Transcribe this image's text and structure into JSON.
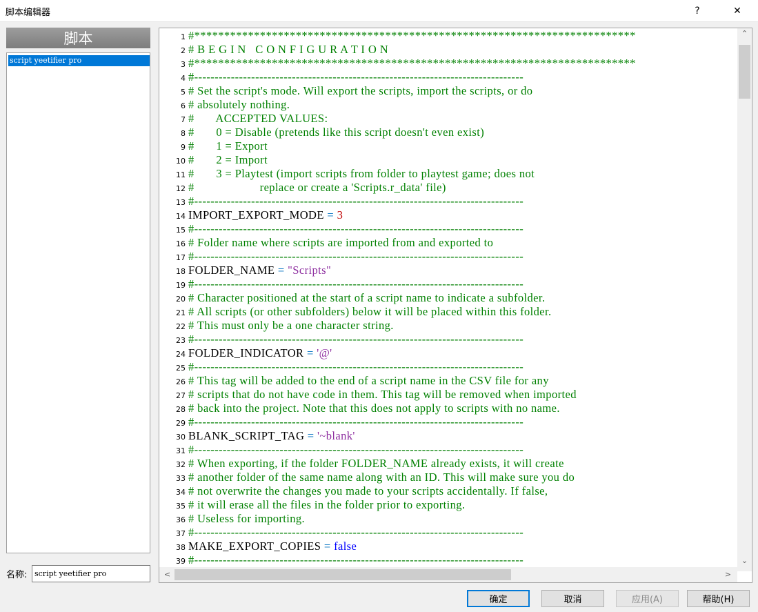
{
  "window": {
    "title": "脚本编辑器",
    "help_glyph": "?",
    "close_glyph": "✕"
  },
  "left_panel": {
    "header": "脚本",
    "scripts": [
      "script yeetifier pro"
    ],
    "name_label": "名称:",
    "name_value": "script yeetifier pro"
  },
  "editor": {
    "lines": [
      {
        "n": "1",
        "segs": [
          {
            "t": "#**************************************************************************",
            "c": "c-comment"
          }
        ]
      },
      {
        "n": "2",
        "segs": [
          {
            "t": "# B E G I N   C O N F I G U R A T I O N",
            "c": "c-comment"
          }
        ]
      },
      {
        "n": "3",
        "segs": [
          {
            "t": "#**************************************************************************",
            "c": "c-comment"
          }
        ]
      },
      {
        "n": "4",
        "segs": [
          {
            "t": "#---------------------------------------------------------------------------------",
            "c": "c-comment"
          }
        ]
      },
      {
        "n": "5",
        "segs": [
          {
            "t": "# Set the script's mode. Will export the scripts, import the scripts, or do",
            "c": "c-comment"
          }
        ]
      },
      {
        "n": "6",
        "segs": [
          {
            "t": "# absolutely nothing.",
            "c": "c-comment"
          }
        ]
      },
      {
        "n": "7",
        "segs": [
          {
            "t": "#       ACCEPTED VALUES:",
            "c": "c-comment"
          }
        ]
      },
      {
        "n": "8",
        "segs": [
          {
            "t": "#       0 = Disable (pretends like this script doesn't even exist)",
            "c": "c-comment"
          }
        ]
      },
      {
        "n": "9",
        "segs": [
          {
            "t": "#       1 = Export",
            "c": "c-comment"
          }
        ]
      },
      {
        "n": "10",
        "segs": [
          {
            "t": "#       2 = Import",
            "c": "c-comment"
          }
        ]
      },
      {
        "n": "11",
        "segs": [
          {
            "t": "#       3 = Playtest (import scripts from folder to playtest game; does not",
            "c": "c-comment"
          }
        ]
      },
      {
        "n": "12",
        "segs": [
          {
            "t": "#                     replace or create a 'Scripts.r_data' file)",
            "c": "c-comment"
          }
        ]
      },
      {
        "n": "13",
        "segs": [
          {
            "t": "#---------------------------------------------------------------------------------",
            "c": "c-comment"
          }
        ]
      },
      {
        "n": "14",
        "segs": [
          {
            "t": "IMPORT_EXPORT_MODE",
            "c": "c-plain"
          },
          {
            "t": " = ",
            "c": "c-op"
          },
          {
            "t": "3",
            "c": "c-num"
          }
        ]
      },
      {
        "n": "15",
        "segs": [
          {
            "t": "#---------------------------------------------------------------------------------",
            "c": "c-comment"
          }
        ]
      },
      {
        "n": "16",
        "segs": [
          {
            "t": "# Folder name where scripts are imported from and exported to",
            "c": "c-comment"
          }
        ]
      },
      {
        "n": "17",
        "segs": [
          {
            "t": "#---------------------------------------------------------------------------------",
            "c": "c-comment"
          }
        ]
      },
      {
        "n": "18",
        "segs": [
          {
            "t": "FOLDER_NAME",
            "c": "c-plain"
          },
          {
            "t": " = ",
            "c": "c-op"
          },
          {
            "t": "\"Scripts\"",
            "c": "c-str"
          }
        ]
      },
      {
        "n": "19",
        "segs": [
          {
            "t": "#---------------------------------------------------------------------------------",
            "c": "c-comment"
          }
        ]
      },
      {
        "n": "20",
        "segs": [
          {
            "t": "# Character positioned at the start of a script name to indicate a subfolder.",
            "c": "c-comment"
          }
        ]
      },
      {
        "n": "21",
        "segs": [
          {
            "t": "# All scripts (or other subfolders) below it will be placed within this folder.",
            "c": "c-comment"
          }
        ]
      },
      {
        "n": "22",
        "segs": [
          {
            "t": "# This must only be a one character string.",
            "c": "c-comment"
          }
        ]
      },
      {
        "n": "23",
        "segs": [
          {
            "t": "#---------------------------------------------------------------------------------",
            "c": "c-comment"
          }
        ]
      },
      {
        "n": "24",
        "segs": [
          {
            "t": "FOLDER_INDICATOR",
            "c": "c-plain"
          },
          {
            "t": " = ",
            "c": "c-op"
          },
          {
            "t": "'@'",
            "c": "c-str"
          }
        ]
      },
      {
        "n": "25",
        "segs": [
          {
            "t": "#---------------------------------------------------------------------------------",
            "c": "c-comment"
          }
        ]
      },
      {
        "n": "26",
        "segs": [
          {
            "t": "# This tag will be added to the end of a script name in the CSV file for any",
            "c": "c-comment"
          }
        ]
      },
      {
        "n": "27",
        "segs": [
          {
            "t": "# scripts that do not have code in them. This tag will be removed when imported",
            "c": "c-comment"
          }
        ]
      },
      {
        "n": "28",
        "segs": [
          {
            "t": "# back into the project. Note that this does not apply to scripts with no name.",
            "c": "c-comment"
          }
        ]
      },
      {
        "n": "29",
        "segs": [
          {
            "t": "#---------------------------------------------------------------------------------",
            "c": "c-comment"
          }
        ]
      },
      {
        "n": "30",
        "segs": [
          {
            "t": "BLANK_SCRIPT_TAG",
            "c": "c-plain"
          },
          {
            "t": " = ",
            "c": "c-op"
          },
          {
            "t": "'~blank'",
            "c": "c-str"
          }
        ]
      },
      {
        "n": "31",
        "segs": [
          {
            "t": "#---------------------------------------------------------------------------------",
            "c": "c-comment"
          }
        ]
      },
      {
        "n": "32",
        "segs": [
          {
            "t": "# When exporting, if the folder FOLDER_NAME already exists, it will create",
            "c": "c-comment"
          }
        ]
      },
      {
        "n": "33",
        "segs": [
          {
            "t": "# another folder of the same name along with an ID. This will make sure you do",
            "c": "c-comment"
          }
        ]
      },
      {
        "n": "34",
        "segs": [
          {
            "t": "# not overwrite the changes you made to your scripts accidentally. If false,",
            "c": "c-comment"
          }
        ]
      },
      {
        "n": "35",
        "segs": [
          {
            "t": "# it will erase all the files in the folder prior to exporting.",
            "c": "c-comment"
          }
        ]
      },
      {
        "n": "36",
        "segs": [
          {
            "t": "# Useless for importing.",
            "c": "c-comment"
          }
        ]
      },
      {
        "n": "37",
        "segs": [
          {
            "t": "#---------------------------------------------------------------------------------",
            "c": "c-comment"
          }
        ]
      },
      {
        "n": "38",
        "segs": [
          {
            "t": "MAKE_EXPORT_COPIES",
            "c": "c-plain"
          },
          {
            "t": " = ",
            "c": "c-op"
          },
          {
            "t": "false",
            "c": "c-kw"
          }
        ]
      },
      {
        "n": "39",
        "segs": [
          {
            "t": "#---------------------------------------------------------------------------------",
            "c": "c-comment"
          }
        ]
      }
    ]
  },
  "buttons": {
    "ok": "确定",
    "cancel": "取消",
    "apply": "应用(A)",
    "help": "帮助(H)"
  },
  "scroll_glyphs": {
    "up": "⌃",
    "down": "⌄",
    "left": "<",
    "right": ">"
  }
}
